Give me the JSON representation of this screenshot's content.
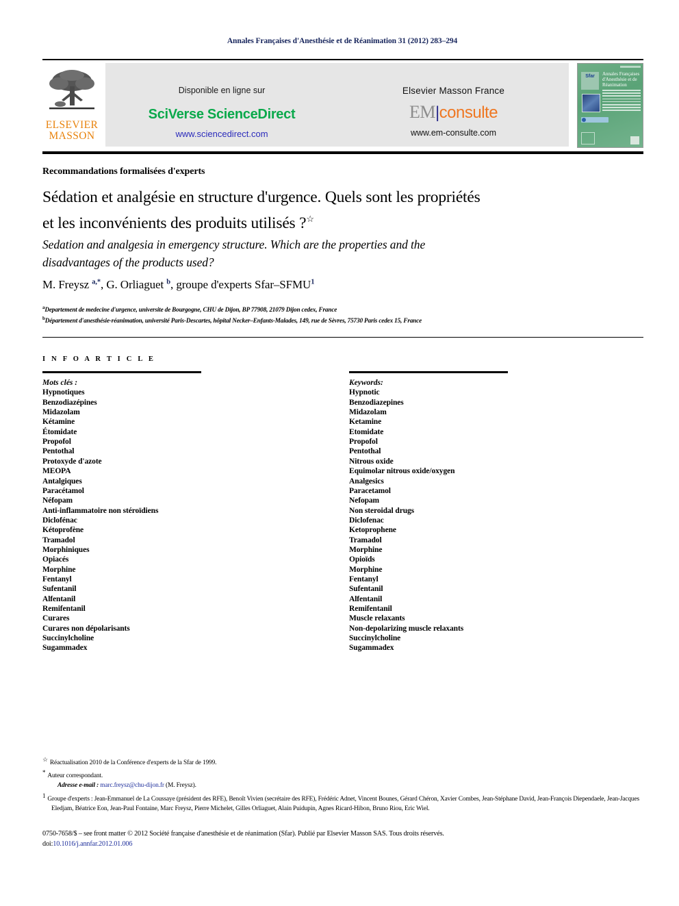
{
  "running_head": "Annales Françaises d'Anesthésie et de Réanimation 31 (2012) 283–294",
  "banner": {
    "publisher_logo_name": "elsevier-tree-logo",
    "publisher_word_1": "ELSEVIER",
    "publisher_word_2": "MASSON",
    "available_label": "Disponible en ligne sur",
    "sciverse_label": "SciVerse ScienceDirect",
    "sciencedirect_url": "www.sciencedirect.com",
    "elsevier_masson_france": "Elsevier Masson France",
    "em_prefix": "EM",
    "em_divider": "|",
    "em_suffix": "consulte",
    "emconsulte_url": "www.em-consulte.com",
    "cover": {
      "sfar_badge": "Sfar",
      "title": "Annales Françaises d'Anesthésie et de Réanimation"
    },
    "colors": {
      "sciverse_green": "#0aa94b",
      "elsevier_orange": "#e8820c",
      "em_orange": "#ef7722",
      "em_grey": "#8c8c8c",
      "banner_background": "#e6e6e6",
      "running_head_navy": "#17255c",
      "link_blue": "#1f2f9c"
    }
  },
  "article": {
    "type": "Recommandations formalisées d'experts",
    "title_fr_line1": "Sédation et analgésie en structure d'urgence. Quels sont les propriétés",
    "title_fr_line2": "et les inconvénients des produits utilisés ?",
    "title_fr_marker": "☆",
    "title_en_line1": "Sedation and analgesia in emergency structure. Which are the properties and the",
    "title_en_line2": "disadvantages of the products used?",
    "authors_part1": "M. Freysz ",
    "authors_sup1": "a,*",
    "authors_part2": ", G. Orliaguet ",
    "authors_sup2": "b",
    "authors_part3": ", groupe d'experts Sfar–SFMU",
    "authors_sup3": "1",
    "affiliation_a_mark": "a",
    "affiliation_a": "Departement de medecine d'urgence, universite de Bourgogne, CHU de Dijon, BP 77908, 21079 Dijon cedex, France",
    "affiliation_b_mark": "b",
    "affiliation_b": "Département d'anesthésie-réanimation, université Paris-Descartes, hôpital Necker–Enfants-Malades, 149, rue de Sèvres, 75730 Paris cedex 15, France"
  },
  "info_section": {
    "label": "I N F O   A R T I C L E"
  },
  "keywords_fr": {
    "heading": "Mots clés :",
    "items": [
      "Hypnotiques",
      "Benzodiazépines",
      "Midazolam",
      "Kétamine",
      "Étomidate",
      "Propofol",
      "Pentothal",
      "Protoxyde d'azote",
      "MEOPA",
      "Antalgiques",
      "Paracétamol",
      "Néfopam",
      "Anti-inflammatoire non stéroïdiens",
      "Diclofénac",
      "Kétoprofène",
      "Tramadol",
      "Morphiniques",
      "Opiacés",
      "Morphine",
      "Fentanyl",
      "Sufentanil",
      "Alfentanil",
      "Remifentanil",
      "Curares",
      "Curares non dépolarisants",
      "Succinylcholine",
      "Sugammadex"
    ]
  },
  "keywords_en": {
    "heading": "Keywords:",
    "items": [
      "Hypnotic",
      "Benzodiazepines",
      "Midazolam",
      "Ketamine",
      "Etomidate",
      "Propofol",
      "Pentothal",
      "Nitrous oxide",
      "Equimolar nitrous oxide/oxygen",
      "Analgesics",
      "Paracetamol",
      "Nefopam",
      "Non steroidal drugs",
      "Diclofenac",
      "Ketoprophene",
      "Tramadol",
      "Morphine",
      "Opioïds",
      "Morphine",
      "Fentanyl",
      "Sufentanil",
      "Alfentanil",
      "Remifentanil",
      "Muscle relaxants",
      "Non-depolarizing muscle relaxants",
      "Succinylcholine",
      "Sugammadex"
    ]
  },
  "footnotes": {
    "star_mark": "☆",
    "star_text": "Réactualisation 2010 de la Conférence d'experts de la Sfar de 1999.",
    "corresponding_mark": "*",
    "corresponding_text": "Auteur correspondant.",
    "email_label": "Adresse e-mail :",
    "email_value": "marc.freysz@chu-dijon.fr",
    "email_suffix": "(M. Freysz).",
    "experts_mark": "1",
    "experts_text": "Groupe d'experts : Jean-Emmanuel de La Coussaye (président des RFE), Benoît Vivien (secrétaire des RFE), Frédéric Adnet, Vincent Bounes, Gérard Chéron, Xavier Combes, Jean-Stéphane David, Jean-François Diependaele, Jean-Jacques Eledjam, Béatrice Eon, Jean-Paul Fontaine, Marc Freysz, Pierre Michelet, Gilles Orliaguet, Alain Puidupin, Agnes Ricard-Hibon, Bruno Riou, Eric Wiel."
  },
  "copyright": {
    "line": "0750-7658/$ – see front matter © 2012 Société française d'anesthésie et de réanimation (Sfar). Publié par Elsevier Masson SAS. Tous droits réservés.",
    "doi_label": "doi:",
    "doi_value": "10.1016/j.annfar.2012.01.006"
  }
}
